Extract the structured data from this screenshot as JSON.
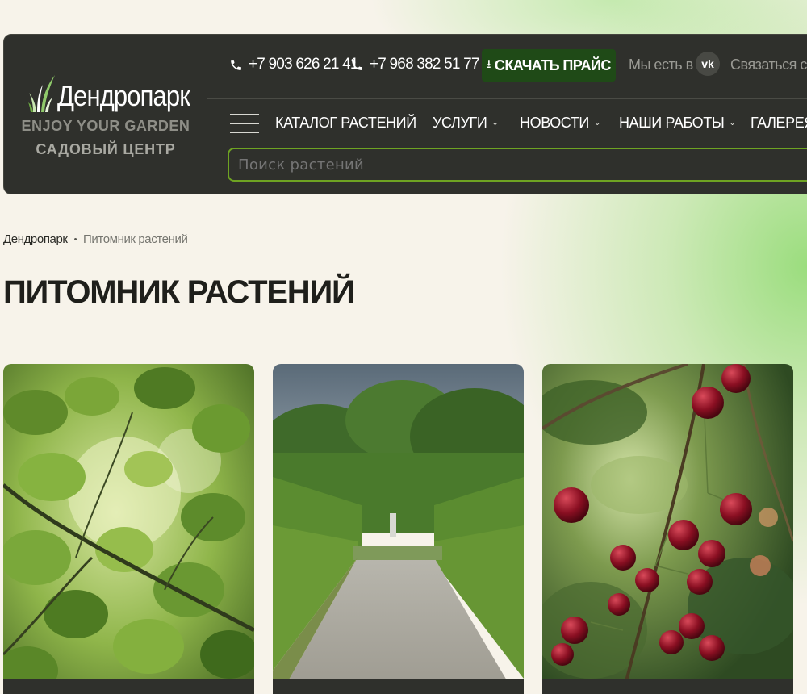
{
  "brand": {
    "name": "Дендропарк",
    "tagline": "ENJOY YOUR GARDEN",
    "subtitle": "САДОВЫЙ ЦЕНТР"
  },
  "topbar": {
    "phones": [
      "+7 903 626 21 41",
      "+7 968 382 51 77"
    ],
    "price_button": "СКАЧАТЬ ПРАЙС",
    "download_glyph": "⭳",
    "social_label": "Мы есть в",
    "vk_label": "vk",
    "contact_label": "Связаться с"
  },
  "nav": {
    "items": [
      {
        "label": "КАТАЛОГ РАСТЕНИЙ",
        "dropdown": false
      },
      {
        "label": "УСЛУГИ",
        "dropdown": true
      },
      {
        "label": "НОВОСТИ",
        "dropdown": true
      },
      {
        "label": "НАШИ РАБОТЫ",
        "dropdown": true
      },
      {
        "label": "ГАЛЕРЕЯ",
        "dropdown": false
      }
    ],
    "chevron": "⌄"
  },
  "search": {
    "placeholder": "Поиск растений"
  },
  "breadcrumb": {
    "home": "Дендропарк",
    "separator": "•",
    "current": "Питомник растений"
  },
  "page": {
    "title": "ПИТОМНИК РАСТЕНИЙ"
  },
  "cards": [
    {
      "image": "green-leaves-photo"
    },
    {
      "image": "hedge-garden-path-photo"
    },
    {
      "image": "cherries-branch-photo"
    }
  ],
  "colors": {
    "header_bg": "#2f302c",
    "accent_green": "#6ea322",
    "price_button_bg": "#1f4a17",
    "page_bg": "#f7f3ea"
  }
}
